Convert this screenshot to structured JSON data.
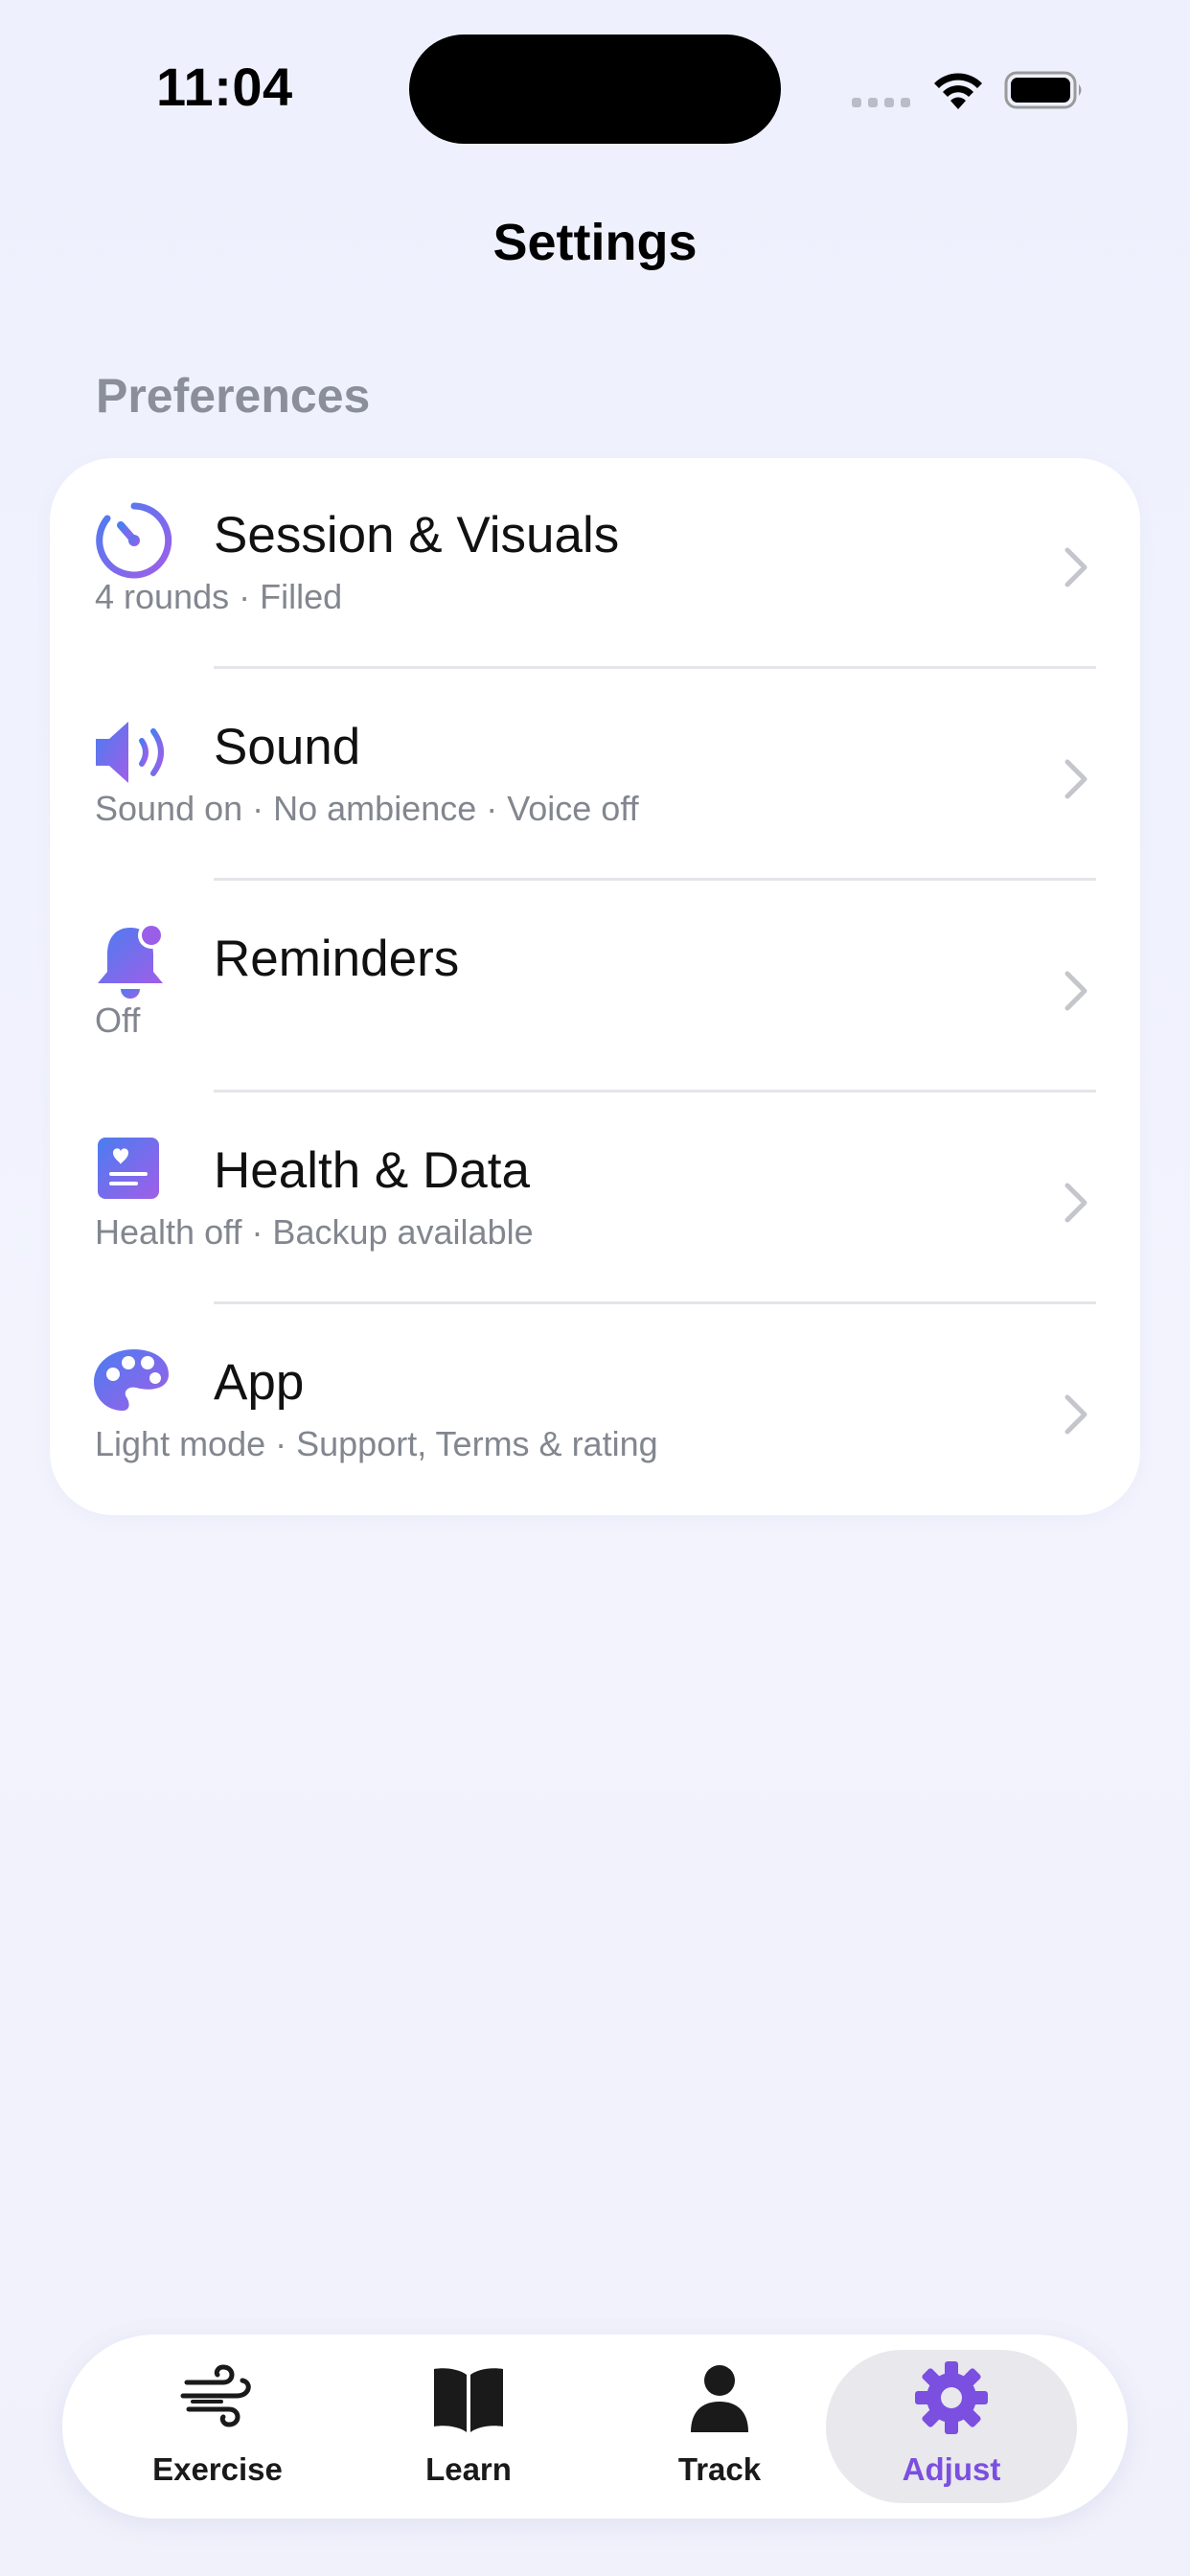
{
  "status_bar": {
    "time": "11:04"
  },
  "header": {
    "title": "Settings"
  },
  "section": {
    "title": "Preferences"
  },
  "rows": [
    {
      "title": "Session & Visuals",
      "subtitle": "4 rounds · Filled",
      "icon": "timer-icon"
    },
    {
      "title": "Sound",
      "subtitle": "Sound on · No ambience · Voice off",
      "icon": "speaker-icon"
    },
    {
      "title": "Reminders",
      "subtitle": "Off",
      "icon": "bell-badge-icon"
    },
    {
      "title": "Health & Data",
      "subtitle": "Health off · Backup available",
      "icon": "health-data-icon"
    },
    {
      "title": "App",
      "subtitle": "Light mode · Support, Terms & rating",
      "icon": "palette-icon"
    }
  ],
  "tab_bar": {
    "tabs": [
      {
        "label": "Exercise",
        "icon": "wind-icon",
        "active": false
      },
      {
        "label": "Learn",
        "icon": "book-icon",
        "active": false
      },
      {
        "label": "Track",
        "icon": "person-icon",
        "active": false
      },
      {
        "label": "Adjust",
        "icon": "gear-icon",
        "active": true
      }
    ]
  },
  "colors": {
    "accent": "#7b4fe0",
    "icon_gradient_start": "#4a7df0",
    "icon_gradient_end": "#a05ee8",
    "background": "#eef1fd",
    "secondary_text": "#82868f"
  }
}
